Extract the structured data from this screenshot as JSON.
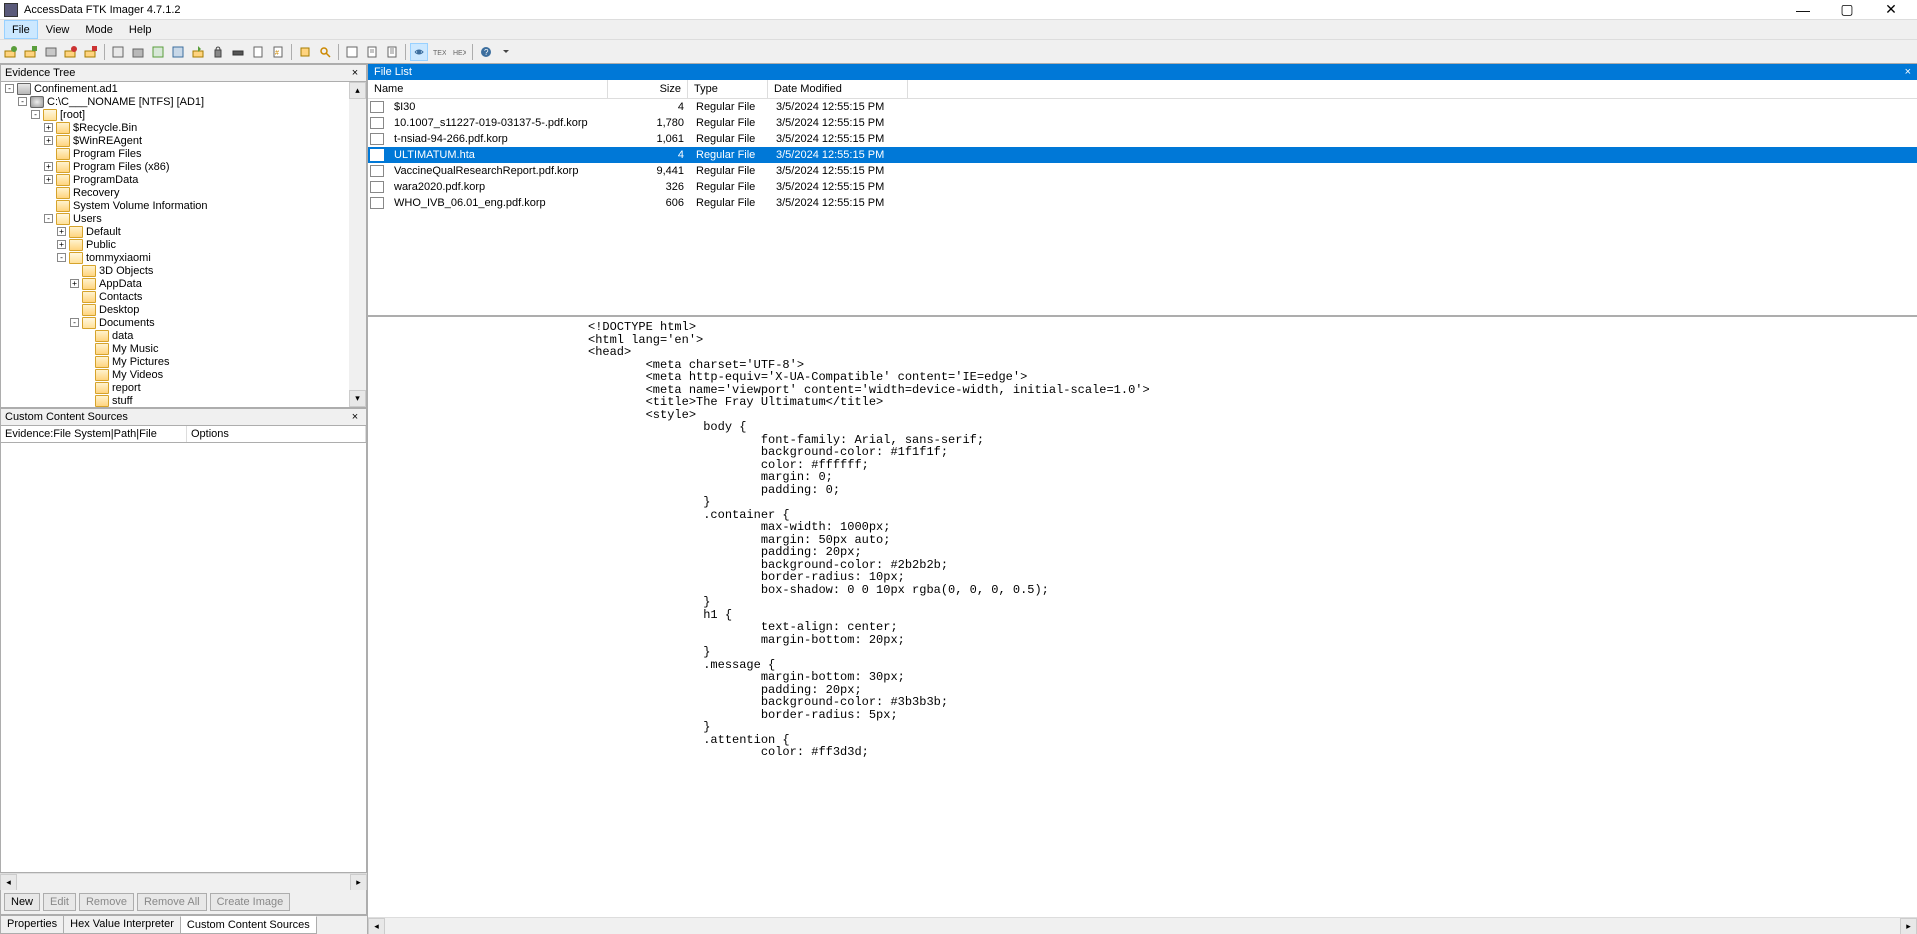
{
  "window": {
    "title": "AccessData FTK Imager 4.7.1.2"
  },
  "menu": {
    "file": "File",
    "view": "View",
    "mode": "Mode",
    "help": "Help"
  },
  "panels": {
    "evidence_tree": "Evidence Tree",
    "file_list": "File List",
    "custom_content": "Custom Content Sources"
  },
  "tree": [
    {
      "depth": 0,
      "exp": "-",
      "icon": "img",
      "label": "Confinement.ad1"
    },
    {
      "depth": 1,
      "exp": "-",
      "icon": "disk",
      "label": "C:\\C___NONAME [NTFS] [AD1]"
    },
    {
      "depth": 2,
      "exp": "-",
      "icon": "folder-open",
      "label": "[root]"
    },
    {
      "depth": 3,
      "exp": "+",
      "icon": "folder",
      "label": "$Recycle.Bin"
    },
    {
      "depth": 3,
      "exp": "+",
      "icon": "folder",
      "label": "$WinREAgent"
    },
    {
      "depth": 3,
      "exp": " ",
      "icon": "folder",
      "label": "Program Files"
    },
    {
      "depth": 3,
      "exp": "+",
      "icon": "folder",
      "label": "Program Files (x86)"
    },
    {
      "depth": 3,
      "exp": "+",
      "icon": "folder",
      "label": "ProgramData"
    },
    {
      "depth": 3,
      "exp": " ",
      "icon": "folder",
      "label": "Recovery"
    },
    {
      "depth": 3,
      "exp": " ",
      "icon": "folder",
      "label": "System Volume Information"
    },
    {
      "depth": 3,
      "exp": "-",
      "icon": "folder-open",
      "label": "Users"
    },
    {
      "depth": 4,
      "exp": "+",
      "icon": "folder",
      "label": "Default"
    },
    {
      "depth": 4,
      "exp": "+",
      "icon": "folder",
      "label": "Public"
    },
    {
      "depth": 4,
      "exp": "-",
      "icon": "folder-open",
      "label": "tommyxiaomi"
    },
    {
      "depth": 5,
      "exp": " ",
      "icon": "folder",
      "label": "3D Objects"
    },
    {
      "depth": 5,
      "exp": "+",
      "icon": "folder",
      "label": "AppData"
    },
    {
      "depth": 5,
      "exp": " ",
      "icon": "folder",
      "label": "Contacts"
    },
    {
      "depth": 5,
      "exp": " ",
      "icon": "folder",
      "label": "Desktop"
    },
    {
      "depth": 5,
      "exp": "-",
      "icon": "folder-open",
      "label": "Documents"
    },
    {
      "depth": 6,
      "exp": " ",
      "icon": "folder",
      "label": "data"
    },
    {
      "depth": 6,
      "exp": " ",
      "icon": "folder",
      "label": "My Music"
    },
    {
      "depth": 6,
      "exp": " ",
      "icon": "folder",
      "label": "My Pictures"
    },
    {
      "depth": 6,
      "exp": " ",
      "icon": "folder",
      "label": "My Videos"
    },
    {
      "depth": 6,
      "exp": " ",
      "icon": "folder",
      "label": "report"
    },
    {
      "depth": 6,
      "exp": " ",
      "icon": "folder",
      "label": "stuff"
    }
  ],
  "filelist": {
    "cols": {
      "name": "Name",
      "size": "Size",
      "type": "Type",
      "date": "Date Modified"
    },
    "rows": [
      {
        "name": "$I30",
        "size": "4",
        "type": "Regular File",
        "date": "3/5/2024 12:55:15 PM",
        "sel": false
      },
      {
        "name": "10.1007_s11227-019-03137-5-.pdf.korp",
        "size": "1,780",
        "type": "Regular File",
        "date": "3/5/2024 12:55:15 PM",
        "sel": false
      },
      {
        "name": "t-nsiad-94-266.pdf.korp",
        "size": "1,061",
        "type": "Regular File",
        "date": "3/5/2024 12:55:15 PM",
        "sel": false
      },
      {
        "name": "ULTIMATUM.hta",
        "size": "4",
        "type": "Regular File",
        "date": "3/5/2024 12:55:15 PM",
        "sel": true
      },
      {
        "name": "VaccineQualResearchReport.pdf.korp",
        "size": "9,441",
        "type": "Regular File",
        "date": "3/5/2024 12:55:15 PM",
        "sel": false
      },
      {
        "name": "wara2020.pdf.korp",
        "size": "326",
        "type": "Regular File",
        "date": "3/5/2024 12:55:15 PM",
        "sel": false
      },
      {
        "name": "WHO_IVB_06.01_eng.pdf.korp",
        "size": "606",
        "type": "Regular File",
        "date": "3/5/2024 12:55:15 PM",
        "sel": false
      }
    ]
  },
  "custom": {
    "col1": "Evidence:File System|Path|File",
    "col2": "Options",
    "btn_new": "New",
    "btn_edit": "Edit",
    "btn_remove": "Remove",
    "btn_removeall": "Remove All",
    "btn_create": "Create Image"
  },
  "tabs": {
    "properties": "Properties",
    "hex": "Hex Value Interpreter",
    "custom": "Custom Content Sources"
  },
  "preview_text": "<!DOCTYPE html>\n<html lang='en'>\n<head>\n        <meta charset='UTF-8'>\n        <meta http-equiv='X-UA-Compatible' content='IE=edge'>\n        <meta name='viewport' content='width=device-width, initial-scale=1.0'>\n        <title>The Fray Ultimatum</title>\n        <style>\n                body {\n                        font-family: Arial, sans-serif;\n                        background-color: #1f1f1f;\n                        color: #ffffff;\n                        margin: 0;\n                        padding: 0;\n                }\n                .container {\n                        max-width: 1000px;\n                        margin: 50px auto;\n                        padding: 20px;\n                        background-color: #2b2b2b;\n                        border-radius: 10px;\n                        box-shadow: 0 0 10px rgba(0, 0, 0, 0.5);\n                }\n                h1 {\n                        text-align: center;\n                        margin-bottom: 20px;\n                }\n                .message {\n                        margin-bottom: 30px;\n                        padding: 20px;\n                        background-color: #3b3b3b;\n                        border-radius: 5px;\n                }\n                .attention {\n                        color: #ff3d3d;"
}
